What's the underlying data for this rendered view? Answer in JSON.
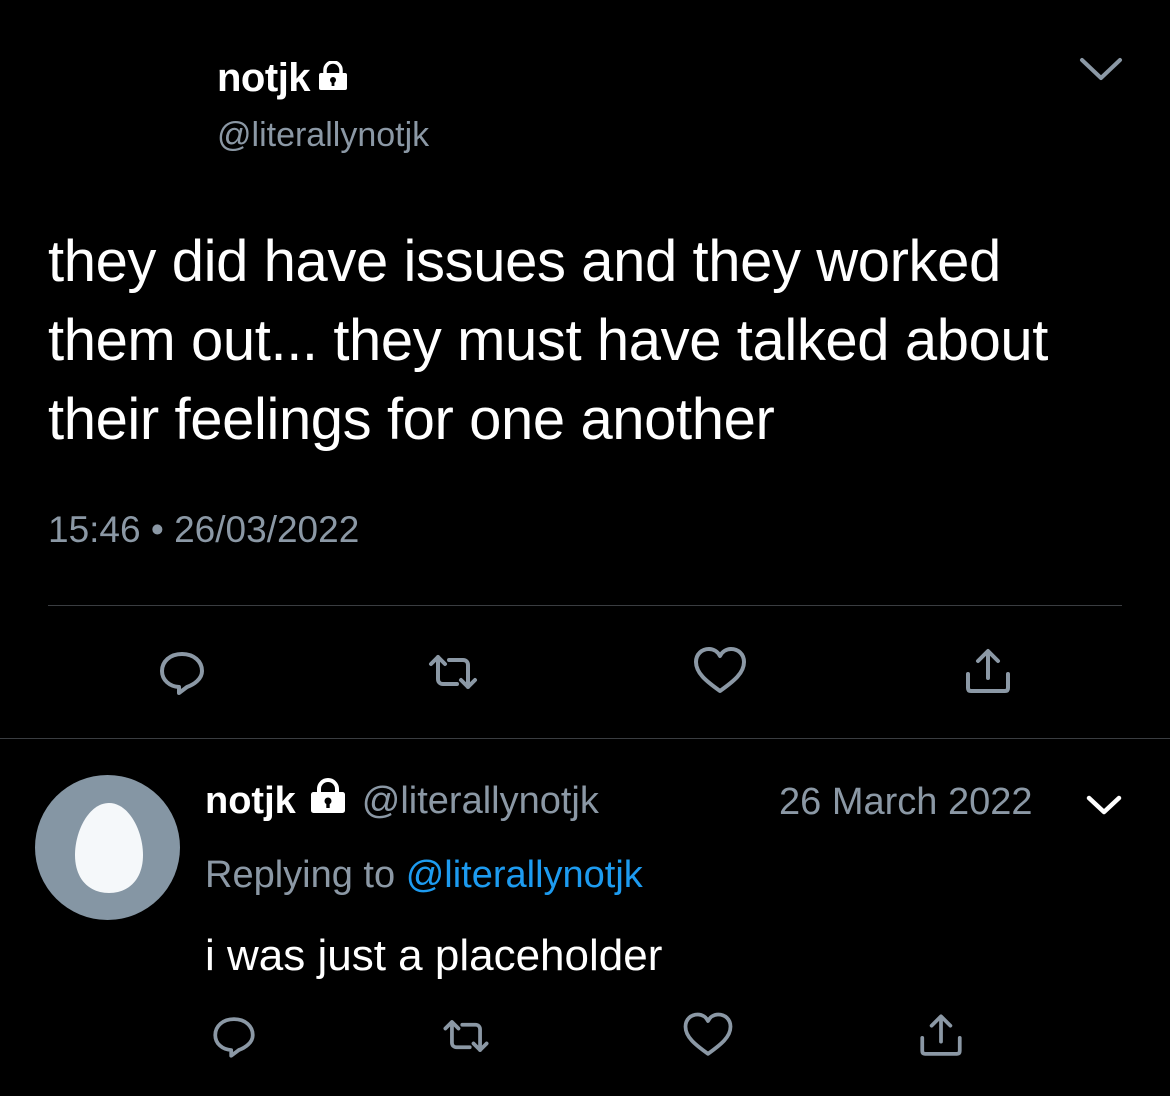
{
  "main_tweet": {
    "display_name": "notjk",
    "handle": "@literallynotjk",
    "text": "they did have issues and they worked them out... they must have talked about their feelings for one another",
    "timestamp": "15:46 • 26/03/2022",
    "icons": [
      "lock-icon",
      "chevron-down-icon",
      "reply-icon",
      "retweet-icon",
      "like-icon",
      "share-icon"
    ]
  },
  "reply_tweet": {
    "display_name": "notjk",
    "handle": "@literallynotjk",
    "date": "26 March 2022",
    "replying_prefix": "Replying to",
    "replying_to": "@literallynotjk",
    "text": "i was just a placeholder",
    "icons": [
      "avatar-egg-icon",
      "lock-icon",
      "chevron-down-icon",
      "reply-icon",
      "retweet-icon",
      "like-icon",
      "share-icon"
    ]
  },
  "colors": {
    "background": "#000000",
    "primary_text": "#ffffff",
    "secondary_text": "#8b98a5",
    "link": "#1d9bf0",
    "divider": "#3a3d41",
    "avatar_bg": "#8596a4"
  }
}
